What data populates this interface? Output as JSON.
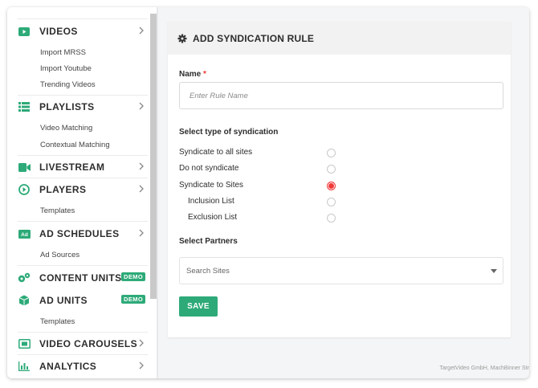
{
  "colors": {
    "accent": "#2daa78",
    "required": "#e33333",
    "radio_selected": "#f03b3b"
  },
  "sidebar": {
    "sections": [
      {
        "label": "VIDEOS",
        "icon": "video-play-icon",
        "sub": [
          "Import MRSS",
          "Import Youtube",
          "Trending Videos"
        ]
      },
      {
        "label": "PLAYLISTS",
        "icon": "playlist-icon",
        "sub": [
          "Video Matching",
          "Contextual Matching"
        ]
      },
      {
        "label": "LIVESTREAM",
        "icon": "camera-icon",
        "sub": []
      },
      {
        "label": "PLAYERS",
        "icon": "play-circle-icon",
        "sub": [
          "Templates"
        ]
      },
      {
        "label": "AD SCHEDULES",
        "icon": "ad-icon",
        "sub": [
          "Ad Sources"
        ]
      },
      {
        "label": "CONTENT UNITS",
        "icon": "gears-icon",
        "badge": "DEMO",
        "sub": []
      },
      {
        "label": "AD UNITS",
        "icon": "cube-icon",
        "badge": "DEMO",
        "sub": [
          "Templates"
        ]
      },
      {
        "label": "VIDEO CAROUSELS",
        "icon": "carousel-icon",
        "sub": []
      },
      {
        "label": "ANALYTICS",
        "icon": "bar-chart-icon",
        "sub": []
      }
    ]
  },
  "form": {
    "title": "ADD SYNDICATION RULE",
    "title_icon": "gear-icon",
    "name_label": "Name",
    "name_required": "*",
    "name_placeholder": "Enter Rule Name",
    "syndication_label": "Select type of syndication",
    "options": [
      {
        "label": "Syndicate to all sites",
        "selected": false
      },
      {
        "label": "Do not syndicate",
        "selected": false
      },
      {
        "label": "Syndicate to Sites",
        "selected": true
      },
      {
        "label": "Inclusion List",
        "selected": false
      },
      {
        "label": "Exclusion List",
        "selected": false
      }
    ],
    "partners_label": "Select Partners",
    "partners_placeholder": "Search Sites",
    "save_label": "SAVE"
  },
  "footer": {
    "text": "TargetVideo GmbH, MachBinner Str"
  }
}
